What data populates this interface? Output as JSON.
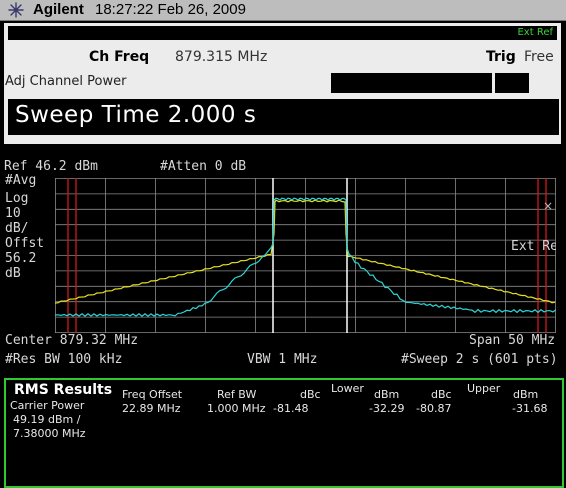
{
  "titlebar": {
    "brand": "Agilent",
    "timestamp": "18:27:22  Feb 26, 2009"
  },
  "info": {
    "ext_ref": "Ext Ref",
    "ch_freq_label": "Ch Freq",
    "ch_freq_value": "879.315 MHz",
    "trig_label": "Trig",
    "trig_value": "Free",
    "measurement": "Adj Channel Power",
    "sweep_time": "Sweep Time 2.000  s"
  },
  "spectrum": {
    "ref": "Ref 46.2 dBm",
    "atten": "#Atten 0 dB",
    "avg": "#Avg",
    "scale_type": "Log",
    "scale_value": "10",
    "scale_unit": "dB/",
    "offset_label": "Offst",
    "offset_value": "56.2",
    "offset_unit": "dB",
    "ext_ref": "Ext Ref",
    "marker_symbol": "×",
    "center": "Center 879.32 MHz",
    "span": "Span 50 MHz",
    "res_bw": "#Res BW 100 kHz",
    "vbw": "VBW 1 MHz",
    "sweep": "#Sweep 2 s (601 pts)",
    "colors": {
      "grid": "#8a8a8a",
      "trace_yellow": "#e6e022",
      "trace_cyan": "#2ed6d6",
      "limit_red": "#d01a1a",
      "channel_white": "#ffffff"
    }
  },
  "results": {
    "title": "RMS Results",
    "carrier_power_label": "Carrier Power",
    "carrier_power_value": "49.19 dBm /",
    "carrier_bw": "7.38000 MHz",
    "headers": {
      "freq_offset": "Freq Offset",
      "ref_bw": "Ref BW",
      "dbc1": "dBc",
      "lower": "Lower",
      "dbm1": "dBm",
      "dbc2": "dBc",
      "upper": "Upper",
      "dbm2": "dBm"
    },
    "row": {
      "freq_offset": "22.89 MHz",
      "ref_bw": "1.000 MHz",
      "lower_dbc": "-81.48",
      "lower_dbm": "-32.29",
      "upper_dbc": "-80.87",
      "upper_dbm": "-31.68"
    }
  }
}
